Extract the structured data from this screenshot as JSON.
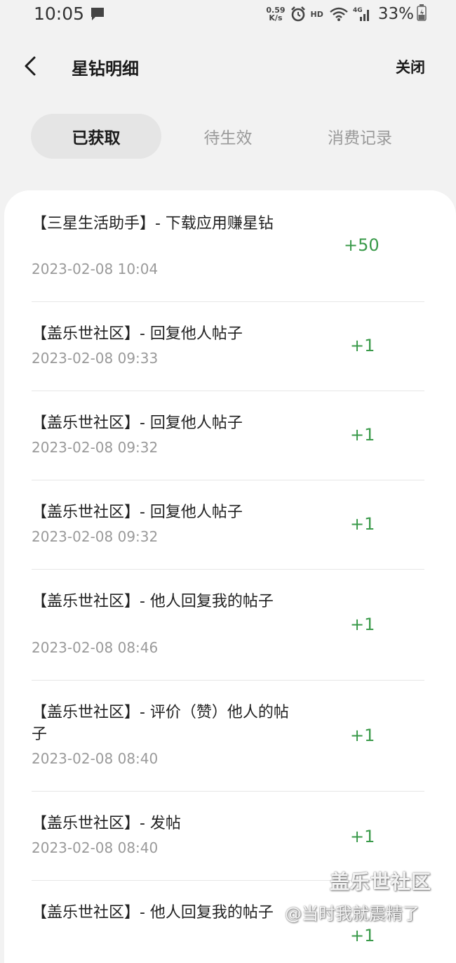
{
  "status_bar": {
    "time": "10:05",
    "net_speed_value": "0.59",
    "net_speed_unit": "K/s",
    "hd_label": "HD",
    "network_type": "4G",
    "battery": "33%"
  },
  "header": {
    "title": "星钻明细",
    "close_label": "关闭"
  },
  "tabs": [
    {
      "label": "已获取",
      "active": true
    },
    {
      "label": "待生效",
      "active": false
    },
    {
      "label": "消费记录",
      "active": false
    }
  ],
  "records": [
    {
      "title": "【三星生活助手】- 下载应用赚星钻",
      "time": "2023-02-08 10:04",
      "points": "+50"
    },
    {
      "title": "【盖乐世社区】- 回复他人帖子",
      "time": "2023-02-08 09:33",
      "points": "+1"
    },
    {
      "title": "【盖乐世社区】- 回复他人帖子",
      "time": "2023-02-08 09:32",
      "points": "+1"
    },
    {
      "title": "【盖乐世社区】- 回复他人帖子",
      "time": "2023-02-08 09:32",
      "points": "+1"
    },
    {
      "title": "【盖乐世社区】- 他人回复我的帖子",
      "time": "2023-02-08 08:46",
      "points": "+1"
    },
    {
      "title": "【盖乐世社区】- 评价（赞）他人的帖子",
      "time": "2023-02-08 08:40",
      "points": "+1"
    },
    {
      "title": "【盖乐世社区】- 发帖",
      "time": "2023-02-08 08:40",
      "points": "+1"
    },
    {
      "title": "【盖乐世社区】- 他人回复我的帖子",
      "time": "",
      "points": "+1"
    }
  ],
  "watermark": {
    "brand": "盖乐世社区",
    "user": "@当时我就震精了"
  },
  "colors": {
    "points_green": "#3a9a4a",
    "page_background": "#f2f2f2",
    "active_tab_background": "#e5e5e5"
  },
  "icons": {
    "back": "chevron-left-icon",
    "message": "message-icon",
    "alarm": "alarm-icon",
    "wifi": "wifi-icon",
    "signal": "signal-icon",
    "battery": "battery-icon"
  }
}
